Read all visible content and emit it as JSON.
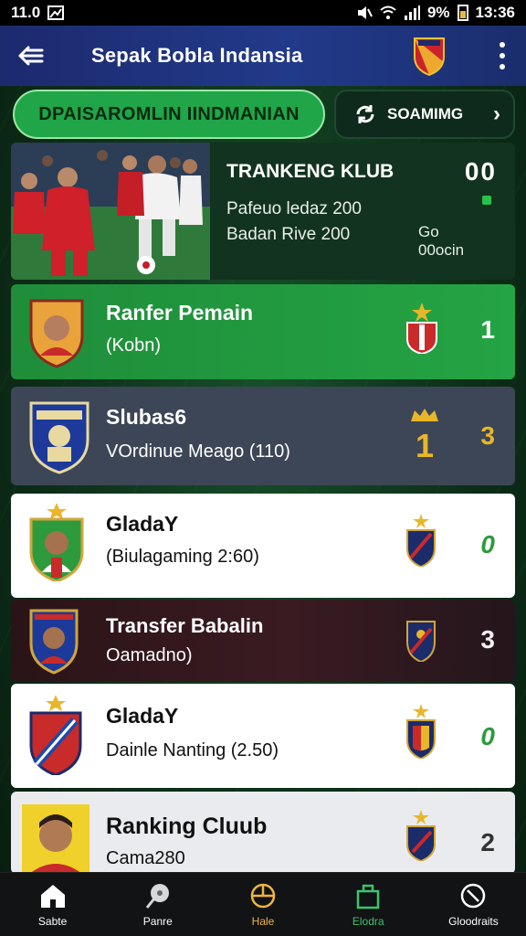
{
  "status": {
    "time": "11.0",
    "battery": "9%",
    "clock": "13:36"
  },
  "appbar": {
    "title": "Sepak Bobla Indansia"
  },
  "tabs": {
    "primary": "DPAISAROMLIN IINDMANIAN",
    "secondary": "SOAMIMG"
  },
  "hero": {
    "title": "TRANKENG KLUB",
    "score": "00",
    "line1": "Pafeuo ledaz 200",
    "line2": "Badan Rive 200",
    "mini1": "Go",
    "mini2": "00ocin"
  },
  "rows": [
    {
      "name": "Ranfer Pemain",
      "sub": "(Kobn)",
      "rank": "1"
    },
    {
      "name": "Slubas6",
      "sub": "VOrdinue Meago (110)",
      "rank": "3",
      "badge": "1"
    },
    {
      "name": "GladaY",
      "sub": "(Biulagaming 2:60)",
      "rank": "0"
    },
    {
      "name": "Transfer Babalin",
      "sub": "Oamadno)",
      "rank": "3"
    },
    {
      "name": "GladaY",
      "sub": "Dainle Nanting (2.50)",
      "rank": "0"
    },
    {
      "name": "Ranking Cluub",
      "sub": "Cama280",
      "rank": "2"
    }
  ],
  "nav": [
    {
      "label": "Sabte",
      "icon": "home-icon"
    },
    {
      "label": "Panre",
      "icon": "ball-icon"
    },
    {
      "label": "Hale",
      "icon": "target-icon",
      "active": true
    },
    {
      "label": "Elodra",
      "icon": "bag-icon"
    },
    {
      "label": "Gloodraits",
      "icon": "timer-icon"
    }
  ],
  "colors": {
    "accent_green": "#20a548",
    "gold": "#e8b62a",
    "appbar_blue": "#223a8a"
  }
}
